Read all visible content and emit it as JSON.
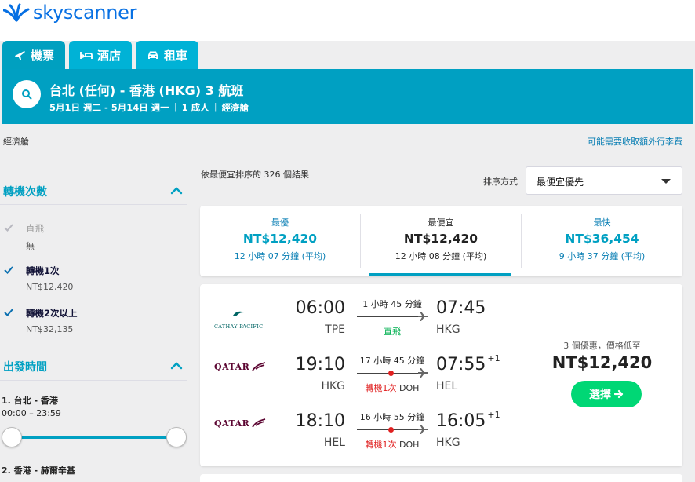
{
  "brand": {
    "name": "skyscanner",
    "color": "#0770e3"
  },
  "tabs": [
    {
      "label": "機票",
      "icon": "plane-icon",
      "active": true
    },
    {
      "label": "酒店",
      "icon": "bed-icon",
      "active": false
    },
    {
      "label": "租車",
      "icon": "car-icon",
      "active": false
    }
  ],
  "search": {
    "title": "台北 (任何) - 香港 (HKG) 3 航班",
    "dates": "5月1日 週二 - 5月14日 週一",
    "travellers": "1 成人",
    "cabin": "經濟艙"
  },
  "subheader": {
    "cabin": "經濟艙",
    "fee_notice": "可能需要收取額外行李費"
  },
  "filters": {
    "stops": {
      "title": "轉機次數",
      "options": [
        {
          "label": "直飛",
          "price": "無",
          "checked": true,
          "disabled": true
        },
        {
          "label": "轉機1次",
          "price": "NT$12,420",
          "checked": true,
          "disabled": false
        },
        {
          "label": "轉機2次以上",
          "price": "NT$32,135",
          "checked": true,
          "disabled": false
        }
      ]
    },
    "departure": {
      "title": "出發時間",
      "legs": [
        {
          "label": "1. 台北 - 香港",
          "range": "00:00 – 23:59"
        },
        {
          "label": "2. 香港 - 赫爾辛基"
        }
      ]
    }
  },
  "results": {
    "count_text": "依最便宜排序的 326 個結果",
    "sort_label": "排序方式",
    "sort_value": "最便宜優先"
  },
  "sort_tabs": [
    {
      "label": "最優",
      "price": "NT$12,420",
      "duration": "12 小時 07 分鐘 (平均)",
      "active": false
    },
    {
      "label": "最便宜",
      "price": "NT$12,420",
      "duration": "12 小時 08 分鐘 (平均)",
      "active": true
    },
    {
      "label": "最快",
      "price": "NT$36,454",
      "duration": "9 小時 37 分鐘 (平均)",
      "active": false
    }
  ],
  "itinerary": {
    "legs": [
      {
        "airline": "CATHAY PACIFIC",
        "dep_time": "06:00",
        "dep_airport": "TPE",
        "duration": "1 小時 45 分鐘",
        "stops": "直飛",
        "stop_code": "",
        "arr_time": "07:45",
        "arr_day": "",
        "arr_airport": "HKG"
      },
      {
        "airline": "QATAR",
        "dep_time": "19:10",
        "dep_airport": "HKG",
        "duration": "17 小時 45 分鐘",
        "stops": "轉機1次",
        "stop_code": "DOH",
        "arr_time": "07:55",
        "arr_day": "+1",
        "arr_airport": "HEL"
      },
      {
        "airline": "QATAR",
        "dep_time": "18:10",
        "dep_airport": "HEL",
        "duration": "16 小時 55 分鐘",
        "stops": "轉機1次",
        "stop_code": "DOH",
        "arr_time": "16:05",
        "arr_day": "+1",
        "arr_airport": "HKG"
      }
    ],
    "deal_count": "3 個優惠，價格低至",
    "price": "NT$12,420",
    "select_label": "選擇"
  },
  "colors": {
    "accent": "#00a0c2",
    "cta": "#00d775",
    "stop_red": "#e02020",
    "direct_green": "#00b050"
  }
}
